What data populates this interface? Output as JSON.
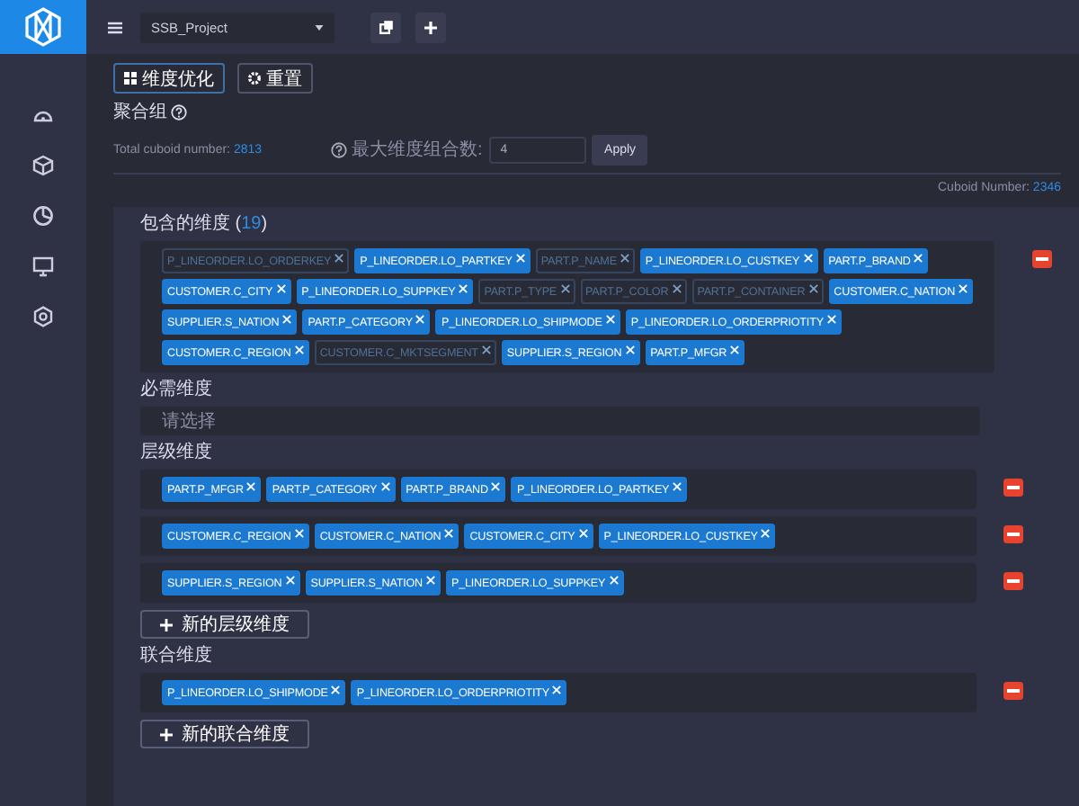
{
  "project_select": {
    "value": "SSB_Project"
  },
  "toolbar": [
    {
      "kind": "grid",
      "label": "维度优化"
    },
    {
      "kind": "gear",
      "label": "重置"
    }
  ],
  "aggregation_group": {
    "title": "聚合组",
    "total_label": "Total cuboid number:",
    "total_value": "2813",
    "max_label": "最大维度组合数:",
    "max_value": "4",
    "apply": "Apply"
  },
  "cuboid_number": {
    "label": "Cuboid Number:",
    "value": "2346"
  },
  "included": {
    "title": "包含的维度",
    "count_open": "(",
    "count": "19",
    "count_close": ")",
    "tags": [
      {
        "label": "P_LINEORDER.LO_ORDERKEY",
        "selected": false
      },
      {
        "label": "P_LINEORDER.LO_PARTKEY",
        "selected": true
      },
      {
        "label": "PART.P_NAME",
        "selected": false
      },
      {
        "label": "P_LINEORDER.LO_CUSTKEY",
        "selected": true
      },
      {
        "label": "PART.P_BRAND",
        "selected": true
      },
      {
        "label": "CUSTOMER.C_CITY",
        "selected": true
      },
      {
        "label": "P_LINEORDER.LO_SUPPKEY",
        "selected": true
      },
      {
        "label": "PART.P_TYPE",
        "selected": false
      },
      {
        "label": "PART.P_COLOR",
        "selected": false
      },
      {
        "label": "PART.P_CONTAINER",
        "selected": false
      },
      {
        "label": "CUSTOMER.C_NATION",
        "selected": true
      },
      {
        "label": "SUPPLIER.S_NATION",
        "selected": true
      },
      {
        "label": "PART.P_CATEGORY",
        "selected": true
      },
      {
        "label": "P_LINEORDER.LO_SHIPMODE",
        "selected": true
      },
      {
        "label": "P_LINEORDER.LO_ORDERPRIOTITY",
        "selected": true
      },
      {
        "label": "CUSTOMER.C_REGION",
        "selected": true
      },
      {
        "label": "CUSTOMER.C_MKTSEGMENT",
        "selected": false
      },
      {
        "label": "SUPPLIER.S_REGION",
        "selected": true
      },
      {
        "label": "PART.P_MFGR",
        "selected": true
      }
    ]
  },
  "mandatory": {
    "title": "必需维度",
    "placeholder": "请选择"
  },
  "hierarchy": {
    "title": "层级维度",
    "rows": [
      [
        "PART.P_MFGR",
        "PART.P_CATEGORY",
        "PART.P_BRAND",
        "P_LINEORDER.LO_PARTKEY"
      ],
      [
        "CUSTOMER.C_REGION",
        "CUSTOMER.C_NATION",
        "CUSTOMER.C_CITY",
        "P_LINEORDER.LO_CUSTKEY"
      ],
      [
        "SUPPLIER.S_REGION",
        "SUPPLIER.S_NATION",
        "P_LINEORDER.LO_SUPPKEY"
      ]
    ],
    "add": "新的层级维度"
  },
  "joint": {
    "title": "联合维度",
    "rows": [
      [
        "P_LINEORDER.LO_SHIPMODE",
        "P_LINEORDER.LO_ORDERPRIOTITY"
      ]
    ],
    "add": "新的联合维度"
  }
}
